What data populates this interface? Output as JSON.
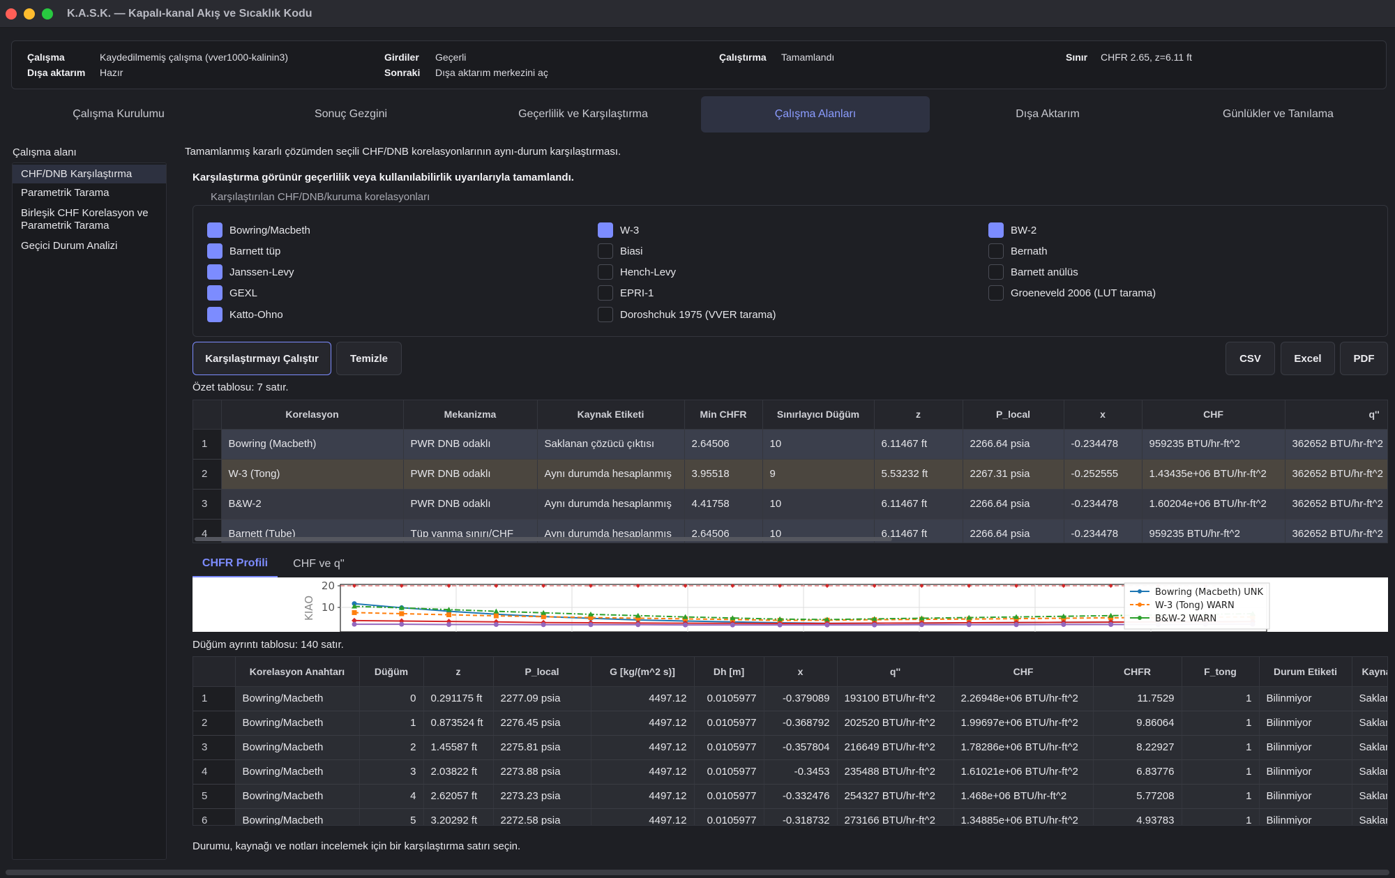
{
  "window": {
    "title": "K.A.S.K. — Kapalı-kanal Akış ve Sıcaklık Kodu"
  },
  "status": {
    "calisma_label": "Çalışma",
    "calisma_value": "Kaydedilmemiş çalışma (vver1000-kalinin3)",
    "disa_label": "Dışa aktarım",
    "disa_value": "Hazır",
    "girdiler_label": "Girdiler",
    "girdiler_value": "Geçerli",
    "sonraki_label": "Sonraki",
    "sonraki_value": "Dışa aktarım merkezini aç",
    "calistirma_label": "Çalıştırma",
    "calistirma_value": "Tamamlandı",
    "sinir_label": "Sınır",
    "sinir_value": "CHFR 2.65, z=6.11  ft"
  },
  "tabs": [
    {
      "label": "Çalışma Kurulumu"
    },
    {
      "label": "Sonuç Gezgini"
    },
    {
      "label": "Geçerlilik ve Karşılaştırma"
    },
    {
      "label": "Çalışma Alanları"
    },
    {
      "label": "Dışa Aktarım"
    },
    {
      "label": "Günlükler ve Tanılama"
    }
  ],
  "sidebar": {
    "label": "Çalışma alanı",
    "items": [
      {
        "label": "CHF/DNB Karşılaştırma"
      },
      {
        "label": "Parametrik Tarama"
      },
      {
        "label": "Birleşik CHF Korelasyon ve Parametrik Tarama"
      },
      {
        "label": "Geçici Durum Analizi"
      }
    ]
  },
  "main": {
    "description": "Tamamlanmış kararlı çözümden seçili CHF/DNB korelasyonlarının aynı-durum karşılaştırması.",
    "warning": "Karşılaştırma görünür geçerlilik veya kullanılabilirlik uyarılarıyla tamamlandı.",
    "group_title": "Karşılaştırılan CHF/DNB/kuruma korelasyonları",
    "checkboxes": [
      {
        "label": "Bowring/Macbeth",
        "checked": true
      },
      {
        "label": "Barnett tüp",
        "checked": true
      },
      {
        "label": "Janssen-Levy",
        "checked": true
      },
      {
        "label": "GEXL",
        "checked": true
      },
      {
        "label": "Katto-Ohno",
        "checked": true
      },
      {
        "label": "W-3",
        "checked": true
      },
      {
        "label": "Biasi",
        "checked": false
      },
      {
        "label": "Hench-Levy",
        "checked": false
      },
      {
        "label": "EPRI-1",
        "checked": false
      },
      {
        "label": "Doroshchuk 1975 (VVER tarama)",
        "checked": false
      },
      {
        "label": "BW-2",
        "checked": true
      },
      {
        "label": "Bernath",
        "checked": false
      },
      {
        "label": "Barnett anülüs",
        "checked": false
      },
      {
        "label": "Groeneveld 2006 (LUT tarama)",
        "checked": false
      }
    ],
    "buttons": {
      "run": "Karşılaştırmayı Çalıştır",
      "clear": "Temizle",
      "csv": "CSV",
      "excel": "Excel",
      "pdf": "PDF"
    },
    "summary_caption": "Özet tablosu: 7 satır.",
    "summary_table": {
      "headers": [
        "Korelasyon",
        "Mekanizma",
        "Kaynak Etiketi",
        "Min CHFR",
        "Sınırlayıcı Düğüm",
        "z",
        "P_local",
        "x",
        "CHF",
        "q''"
      ],
      "rows": [
        [
          "1",
          "Bowring (Macbeth)",
          "PWR DNB odaklı",
          "Saklanan çözücü çıktısı",
          "2.64506",
          "10",
          "6.11467 ft",
          "2266.64 psia",
          "-0.234478",
          "959235 BTU/hr-ft^2",
          "362652 BTU/hr-ft^2"
        ],
        [
          "2",
          "W-3 (Tong)",
          "PWR DNB odaklı",
          "Aynı durumda hesaplanmış",
          "3.95518",
          "9",
          "5.53232 ft",
          "2267.31 psia",
          "-0.252555",
          "1.43435e+06 BTU/hr-ft^2",
          "362652 BTU/hr-ft^2"
        ],
        [
          "3",
          "B&W-2",
          "PWR DNB odaklı",
          "Aynı durumda hesaplanmış",
          "4.41758",
          "10",
          "6.11467 ft",
          "2266.64 psia",
          "-0.234478",
          "1.60204e+06 BTU/hr-ft^2",
          "362652 BTU/hr-ft^2"
        ],
        [
          "4",
          "Barnett (Tube)",
          "Tüp yanma sınırı/CHF",
          "Aynı durumda hesaplanmış",
          "2.64506",
          "10",
          "6.11467 ft",
          "2266.64 psia",
          "-0.234478",
          "959235 BTU/hr-ft^2",
          "362652 BTU/hr-ft^2"
        ]
      ]
    },
    "chart_tabs": [
      {
        "label": "CHFR Profili"
      },
      {
        "label": "CHF ve q''"
      }
    ],
    "detail_caption": "Düğüm ayrıntı tablosu: 140 satır.",
    "detail_table": {
      "headers": [
        "Korelasyon Anahtarı",
        "Düğüm",
        "z",
        "P_local",
        "G [kg/(m^2 s)]",
        "Dh [m]",
        "x",
        "q''",
        "CHF",
        "CHFR",
        "F_tong",
        "Durum Etiketi",
        "Kaynak"
      ],
      "rows": [
        [
          "1",
          "Bowring/Macbeth",
          "0",
          "0.291175 ft",
          "2277.09 psia",
          "4497.12",
          "0.0105977",
          "-0.379089",
          "193100 BTU/hr-ft^2",
          "2.26948e+06 BTU/hr-ft^2",
          "11.7529",
          "1",
          "Bilinmiyor",
          "Saklanan çö"
        ],
        [
          "2",
          "Bowring/Macbeth",
          "1",
          "0.873524 ft",
          "2276.45 psia",
          "4497.12",
          "0.0105977",
          "-0.368792",
          "202520 BTU/hr-ft^2",
          "1.99697e+06 BTU/hr-ft^2",
          "9.86064",
          "1",
          "Bilinmiyor",
          "Saklanan çö"
        ],
        [
          "3",
          "Bowring/Macbeth",
          "2",
          "1.45587 ft",
          "2275.81 psia",
          "4497.12",
          "0.0105977",
          "-0.357804",
          "216649 BTU/hr-ft^2",
          "1.78286e+06 BTU/hr-ft^2",
          "8.22927",
          "1",
          "Bilinmiyor",
          "Saklanan çö"
        ],
        [
          "4",
          "Bowring/Macbeth",
          "3",
          "2.03822 ft",
          "2273.88 psia",
          "4497.12",
          "0.0105977",
          "-0.3453",
          "235488 BTU/hr-ft^2",
          "1.61021e+06 BTU/hr-ft^2",
          "6.83776",
          "1",
          "Bilinmiyor",
          "Saklanan çö"
        ],
        [
          "5",
          "Bowring/Macbeth",
          "4",
          "2.62057 ft",
          "2273.23 psia",
          "4497.12",
          "0.0105977",
          "-0.332476",
          "254327 BTU/hr-ft^2",
          "1.468e+06 BTU/hr-ft^2",
          "5.77208",
          "1",
          "Bilinmiyor",
          "Saklanan çö"
        ],
        [
          "6",
          "Bowring/Macbeth",
          "5",
          "3.20292 ft",
          "2272.58 psia",
          "4497.12",
          "0.0105977",
          "-0.318732",
          "273166 BTU/hr-ft^2",
          "1.34885e+06 BTU/hr-ft^2",
          "4.93783",
          "1",
          "Bilinmiyor",
          "Saklanan çö"
        ]
      ]
    },
    "footer_hint": "Durumu, kaynağı ve notları incelemek için bir karşılaştırma satırı seçin."
  },
  "chart_data": {
    "type": "line",
    "ylabel": "KIAO",
    "ylim": [
      0,
      20
    ],
    "yticks": [
      "20",
      "10"
    ],
    "limit_line": 20,
    "x": [
      0,
      1,
      2,
      3,
      4,
      5,
      6,
      7,
      8,
      9,
      10,
      11,
      12,
      13,
      14,
      15,
      16,
      17,
      18,
      19
    ],
    "series": [
      {
        "name": "Bowring (Macbeth) UNK",
        "color": "#1f77b4",
        "marker": "circle",
        "values": [
          11.75,
          9.86,
          8.23,
          6.84,
          5.77,
          4.94,
          4.2,
          3.7,
          3.3,
          2.9,
          2.65,
          2.7,
          2.8,
          2.9,
          3.0,
          3.1,
          3.2,
          3.3,
          3.4,
          3.5
        ]
      },
      {
        "name": "W-3 (Tong) WARN",
        "color": "#ff7f0e",
        "marker": "square",
        "values": [
          7.6,
          7.1,
          6.6,
          6.1,
          5.7,
          5.3,
          5.0,
          4.7,
          4.4,
          4.0,
          4.1,
          4.3,
          4.5,
          4.6,
          4.8,
          5.0,
          5.2,
          5.3,
          5.5,
          5.6
        ]
      },
      {
        "name": "B&W-2 WARN",
        "color": "#2ca02c",
        "marker": "triangle",
        "values": [
          10.5,
          9.8,
          9.0,
          8.2,
          7.5,
          6.8,
          6.2,
          5.6,
          5.1,
          4.6,
          4.4,
          4.7,
          5.0,
          5.3,
          5.6,
          5.9,
          6.2,
          6.5,
          6.8,
          7.1
        ]
      },
      {
        "name": "",
        "color": "#d62728",
        "marker": "diamond",
        "values": [
          3.9,
          3.7,
          3.5,
          3.3,
          3.0,
          2.9,
          2.8,
          2.7,
          2.65,
          2.6,
          2.6,
          2.7,
          2.8,
          2.9,
          3.0,
          3.1,
          3.2,
          3.3,
          3.3,
          3.4
        ]
      },
      {
        "name": "",
        "color": "#9467bd",
        "marker": "circle",
        "values": [
          2.2,
          2.2,
          2.1,
          2.1,
          2.0,
          2.0,
          2.0,
          1.9,
          1.9,
          1.9,
          1.9,
          1.9,
          2.0,
          2.0,
          2.0,
          2.1,
          2.1,
          2.1,
          2.2,
          2.2
        ]
      }
    ],
    "legend": "right"
  }
}
